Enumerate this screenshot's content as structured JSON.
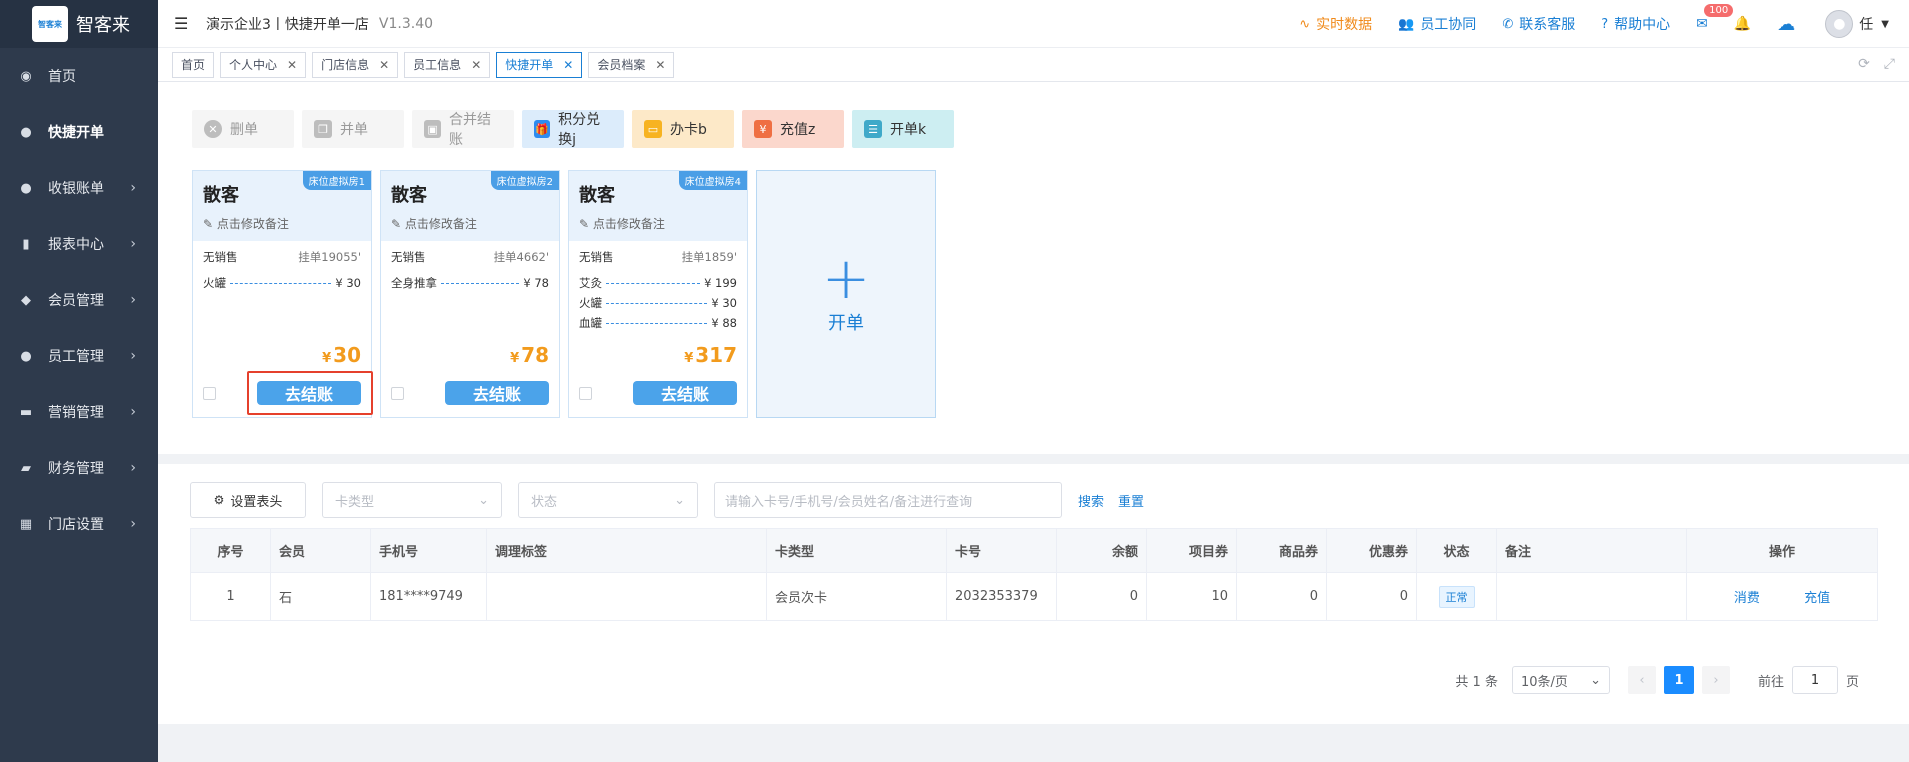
{
  "logo": {
    "mark": "智客来",
    "text": "智客来"
  },
  "sidebar": {
    "items": [
      {
        "label": "首页",
        "icon": "dashboard-icon",
        "glyph": "◉"
      },
      {
        "label": "快捷开单",
        "icon": "money-bag-icon",
        "glyph": "●"
      },
      {
        "label": "收银账单",
        "icon": "money-bag-icon",
        "glyph": "●"
      },
      {
        "label": "报表中心",
        "icon": "bar-chart-icon",
        "glyph": "▮"
      },
      {
        "label": "会员管理",
        "icon": "diamond-icon",
        "glyph": "◆"
      },
      {
        "label": "员工管理",
        "icon": "user-icon",
        "glyph": "●"
      },
      {
        "label": "营销管理",
        "icon": "briefcase-icon",
        "glyph": "▬"
      },
      {
        "label": "财务管理",
        "icon": "wallet-icon",
        "glyph": "▰"
      },
      {
        "label": "门店设置",
        "icon": "grid-icon",
        "glyph": "▦"
      }
    ]
  },
  "topbar": {
    "title": "演示企业3丨快捷开单一店",
    "version": "V1.3.40",
    "links": [
      {
        "label": "实时数据",
        "glyph": "∿"
      },
      {
        "label": "员工协同",
        "glyph": "👥"
      },
      {
        "label": "联系客服",
        "glyph": "✆"
      },
      {
        "label": "帮助中心",
        "glyph": "?"
      }
    ],
    "mail_badge": "100",
    "user": "任"
  },
  "tabs": [
    {
      "label": "首页"
    },
    {
      "label": "个人中心"
    },
    {
      "label": "门店信息"
    },
    {
      "label": "员工信息"
    },
    {
      "label": "快捷开单"
    },
    {
      "label": "会员档案"
    }
  ],
  "actions": [
    {
      "label": "删单",
      "glyph": "✕"
    },
    {
      "label": "并单",
      "glyph": "❐"
    },
    {
      "label": "合并结账",
      "glyph": "▣"
    },
    {
      "label": "积分兑换j",
      "glyph": "🎁"
    },
    {
      "label": "办卡b",
      "glyph": "▭"
    },
    {
      "label": "充值z",
      "glyph": "¥"
    },
    {
      "label": "开单k",
      "glyph": "☰"
    }
  ],
  "cards": [
    {
      "tag": "床位虚拟房1",
      "guest": "散客",
      "note": "点击修改备注",
      "seller": "无销售",
      "hang": "挂单19055'",
      "services": [
        {
          "name": "火罐",
          "price": "¥ 30"
        }
      ],
      "currency": "¥",
      "total": "30",
      "checkout": "去结账"
    },
    {
      "tag": "床位虚拟房2",
      "guest": "散客",
      "note": "点击修改备注",
      "seller": "无销售",
      "hang": "挂单4662'",
      "services": [
        {
          "name": "全身推拿",
          "price": "¥ 78"
        }
      ],
      "currency": "¥",
      "total": "78",
      "checkout": "去结账"
    },
    {
      "tag": "床位虚拟房4",
      "guest": "散客",
      "note": "点击修改备注",
      "seller": "无销售",
      "hang": "挂单1859'",
      "services": [
        {
          "name": "艾灸",
          "price": "¥ 199"
        },
        {
          "name": "火罐",
          "price": "¥ 30"
        },
        {
          "name": "血罐",
          "price": "¥ 88"
        }
      ],
      "currency": "¥",
      "total": "317",
      "checkout": "去结账"
    }
  ],
  "new_card": {
    "label": "开单"
  },
  "filters": {
    "settings": "设置表头",
    "card_type_placeholder": "卡类型",
    "status_placeholder": "状态",
    "search_placeholder": "请输入卡号/手机号/会员姓名/备注进行查询",
    "search": "搜索",
    "reset": "重置"
  },
  "table": {
    "headers": [
      "序号",
      "会员",
      "手机号",
      "调理标签",
      "卡类型",
      "卡号",
      "余额",
      "项目券",
      "商品券",
      "优惠券",
      "状态",
      "备注",
      "操作"
    ],
    "rows": [
      {
        "index": "1",
        "member": "石",
        "phone": "181****9749",
        "tags": "",
        "card_type": "会员次卡",
        "card_no": "2032353379",
        "balance": "0",
        "project_coupon": "10",
        "goods_coupon": "0",
        "discount_coupon": "0",
        "status": "正常",
        "remark": "",
        "op1": "消费",
        "op2": "充值"
      }
    ]
  },
  "pager": {
    "total": "共 1 条",
    "page_size": "10条/页",
    "current": "1",
    "goto": "前往",
    "goto_value": "1",
    "page_unit": "页"
  }
}
